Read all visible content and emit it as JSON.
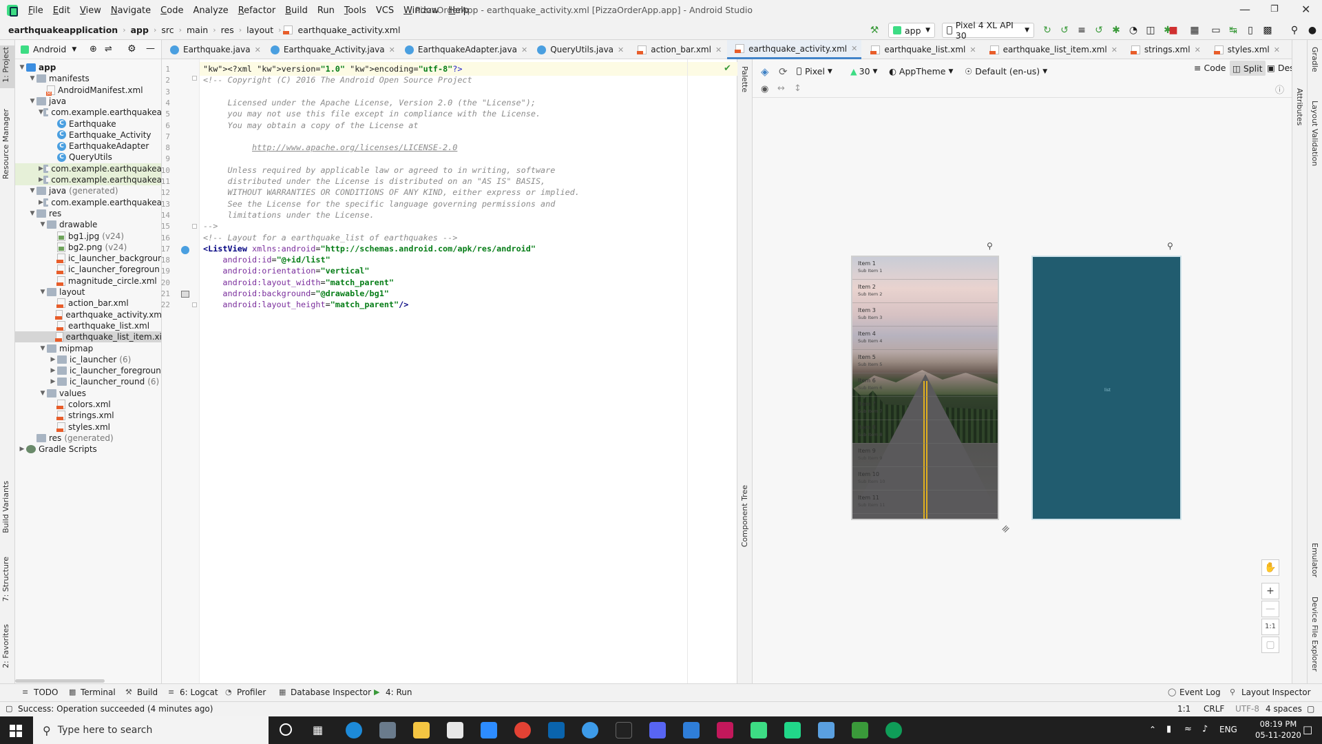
{
  "window": {
    "title": "PizzaOrderApp - earthquake_activity.xml [PizzaOrderApp.app] - Android Studio",
    "menu": [
      {
        "label": "File",
        "u": "F",
        "rest": "ile"
      },
      {
        "label": "Edit",
        "u": "E",
        "rest": "dit"
      },
      {
        "label": "View",
        "u": "V",
        "rest": "iew"
      },
      {
        "label": "Navigate",
        "u": "N",
        "rest": "avigate"
      },
      {
        "label": "Code",
        "u": "C",
        "rest": "ode"
      },
      {
        "label": "Analyze",
        "u": "",
        "rest": "Analyze"
      },
      {
        "label": "Refactor",
        "u": "R",
        "rest": "efactor"
      },
      {
        "label": "Build",
        "u": "B",
        "rest": "uild"
      },
      {
        "label": "Run",
        "u": "",
        "rest": "Run"
      },
      {
        "label": "Tools",
        "u": "T",
        "rest": "ools"
      },
      {
        "label": "VCS",
        "u": "",
        "rest": "VCS"
      },
      {
        "label": "Window",
        "u": "W",
        "rest": "indow"
      },
      {
        "label": "Help",
        "u": "H",
        "rest": "elp"
      }
    ]
  },
  "breadcrumb": [
    "earthquakeapplication",
    "app",
    "src",
    "main",
    "res",
    "layout",
    "earthquake_activity.xml"
  ],
  "toolbar": {
    "run_config": "app",
    "device": "Pixel 4 XL API 30"
  },
  "project": {
    "view_label": "Android",
    "tree": [
      {
        "label": "app",
        "icon": "module",
        "arrow": "▼",
        "depth": 0,
        "bold": true
      },
      {
        "label": "manifests",
        "icon": "folder",
        "arrow": "▼",
        "depth": 1
      },
      {
        "label": "AndroidManifest.xml",
        "icon": "manifest",
        "arrow": "",
        "depth": 2
      },
      {
        "label": "java",
        "icon": "folder",
        "arrow": "▼",
        "depth": 1
      },
      {
        "label": "com.example.earthquakea",
        "icon": "package",
        "arrow": "▼",
        "depth": 2
      },
      {
        "label": "Earthquake",
        "icon": "class",
        "arrow": "",
        "depth": 3
      },
      {
        "label": "Earthquake_Activity",
        "icon": "class",
        "arrow": "",
        "depth": 3
      },
      {
        "label": "EarthquakeAdapter",
        "icon": "class",
        "arrow": "",
        "depth": 3
      },
      {
        "label": "QueryUtils",
        "icon": "class",
        "arrow": "",
        "depth": 3
      },
      {
        "label": "com.example.earthquakea",
        "icon": "package",
        "arrow": "▶",
        "depth": 2,
        "hl": true,
        "suffix": ""
      },
      {
        "label": "com.example.earthquakea",
        "icon": "package",
        "arrow": "▶",
        "depth": 2,
        "hl": true,
        "suffix": ""
      },
      {
        "label": "java",
        "icon": "folder",
        "arrow": "▼",
        "depth": 1,
        "suffix": "(generated)"
      },
      {
        "label": "com.example.earthquakea",
        "icon": "package",
        "arrow": "▶",
        "depth": 2
      },
      {
        "label": "res",
        "icon": "folder",
        "arrow": "▼",
        "depth": 1
      },
      {
        "label": "drawable",
        "icon": "folder",
        "arrow": "▼",
        "depth": 2
      },
      {
        "label": "bg1.jpg",
        "icon": "image",
        "arrow": "",
        "depth": 3,
        "suffix": "(v24)"
      },
      {
        "label": "bg2.png",
        "icon": "image",
        "arrow": "",
        "depth": 3,
        "suffix": "(v24)"
      },
      {
        "label": "ic_launcher_backgrour",
        "icon": "xml",
        "arrow": "",
        "depth": 3
      },
      {
        "label": "ic_launcher_foregroun",
        "icon": "xml",
        "arrow": "",
        "depth": 3
      },
      {
        "label": "magnitude_circle.xml",
        "icon": "xml",
        "arrow": "",
        "depth": 3
      },
      {
        "label": "layout",
        "icon": "folder",
        "arrow": "▼",
        "depth": 2
      },
      {
        "label": "action_bar.xml",
        "icon": "xml",
        "arrow": "",
        "depth": 3
      },
      {
        "label": "earthquake_activity.xm",
        "icon": "xml",
        "arrow": "",
        "depth": 3
      },
      {
        "label": "earthquake_list.xml",
        "icon": "xml",
        "arrow": "",
        "depth": 3
      },
      {
        "label": "earthquake_list_item.xi",
        "icon": "xml",
        "arrow": "",
        "depth": 3,
        "sel": true
      },
      {
        "label": "mipmap",
        "icon": "folder",
        "arrow": "▼",
        "depth": 2
      },
      {
        "label": "ic_launcher",
        "icon": "folder",
        "arrow": "▶",
        "depth": 3,
        "suffix": "(6)"
      },
      {
        "label": "ic_launcher_foregroun",
        "icon": "folder",
        "arrow": "▶",
        "depth": 3
      },
      {
        "label": "ic_launcher_round",
        "icon": "folder",
        "arrow": "▶",
        "depth": 3,
        "suffix": "(6)"
      },
      {
        "label": "values",
        "icon": "folder",
        "arrow": "▼",
        "depth": 2
      },
      {
        "label": "colors.xml",
        "icon": "xml",
        "arrow": "",
        "depth": 3
      },
      {
        "label": "strings.xml",
        "icon": "xml",
        "arrow": "",
        "depth": 3
      },
      {
        "label": "styles.xml",
        "icon": "xml",
        "arrow": "",
        "depth": 3
      },
      {
        "label": "res",
        "icon": "folder",
        "arrow": "",
        "depth": 1,
        "suffix": "(generated)"
      },
      {
        "label": "Gradle Scripts",
        "icon": "gradle",
        "arrow": "▶",
        "depth": 0
      }
    ]
  },
  "tabs": [
    {
      "label": "Earthquake.java",
      "icon": "c"
    },
    {
      "label": "Earthquake_Activity.java",
      "icon": "c"
    },
    {
      "label": "EarthquakeAdapter.java",
      "icon": "c"
    },
    {
      "label": "QueryUtils.java",
      "icon": "c"
    },
    {
      "label": "action_bar.xml",
      "icon": "x"
    },
    {
      "label": "earthquake_activity.xml",
      "icon": "x",
      "active": true
    },
    {
      "label": "earthquake_list.xml",
      "icon": "x"
    },
    {
      "label": "earthquake_list_item.xml",
      "icon": "x"
    },
    {
      "label": "strings.xml",
      "icon": "x"
    },
    {
      "label": "styles.xml",
      "icon": "x"
    }
  ],
  "view_modes": {
    "code": "Code",
    "split": "Split",
    "design": "Design"
  },
  "code_lines": [
    "<?xml version=\"1.0\" encoding=\"utf-8\"?>",
    "<!-- Copyright (C) 2016 The Android Open Source Project",
    "",
    "     Licensed under the Apache License, Version 2.0 (the \"License\");",
    "     you may not use this file except in compliance with the License.",
    "     You may obtain a copy of the License at",
    "",
    "          http://www.apache.org/licenses/LICENSE-2.0",
    "",
    "     Unless required by applicable law or agreed to in writing, software",
    "     distributed under the License is distributed on an \"AS IS\" BASIS,",
    "     WITHOUT WARRANTIES OR CONDITIONS OF ANY KIND, either express or implied.",
    "     See the License for the specific language governing permissions and",
    "     limitations under the License.",
    "-->",
    "<!-- Layout for a earthquake_list of earthquakes -->",
    "<ListView xmlns:android=\"http://schemas.android.com/apk/res/android\"",
    "    android:id=\"@+id/list\"",
    "    android:orientation=\"vertical\"",
    "    android:layout_width=\"match_parent\"",
    "    android:background=\"@drawable/bg1\"",
    "    android:layout_height=\"match_parent\"/>"
  ],
  "design_toolbar": {
    "device": "Pixel",
    "api": "30",
    "theme": "AppTheme",
    "locale": "Default (en-us)"
  },
  "preview": {
    "items": [
      {
        "title": "Item 1",
        "sub": "Sub Item 1"
      },
      {
        "title": "Item 2",
        "sub": "Sub Item 2"
      },
      {
        "title": "Item 3",
        "sub": "Sub Item 3"
      },
      {
        "title": "Item 4",
        "sub": "Sub Item 4"
      },
      {
        "title": "Item 5",
        "sub": "Sub Item 5"
      },
      {
        "title": "Item 6",
        "sub": "Sub Item 6"
      },
      {
        "title": "Item 7",
        "sub": "Sub Item 7"
      },
      {
        "title": "Item 8",
        "sub": "Sub Item 8"
      },
      {
        "title": "Item 9",
        "sub": "Sub Item 9"
      },
      {
        "title": "Item 10",
        "sub": "Sub Item 10"
      },
      {
        "title": "Item 11",
        "sub": "Sub Item 11"
      }
    ],
    "blueprint_label": "list"
  },
  "side_tabs": {
    "project": "1: Project",
    "resource_manager": "Resource Manager",
    "build_variants": "Build Variants",
    "structure": "7: Structure",
    "favorites": "2: Favorites",
    "palette": "Palette",
    "component_tree": "Component Tree",
    "gradle": "Gradle",
    "attributes": "Attributes",
    "layout_validation": "Layout Validation",
    "emulator": "Emulator",
    "device_file_explorer": "Device File Explorer"
  },
  "bottom_tools": {
    "todo": "TODO",
    "terminal": "Terminal",
    "build": "Build",
    "logcat": "6: Logcat",
    "profiler": "Profiler",
    "db_inspector": "Database Inspector",
    "run": "4: Run",
    "event_log": "Event Log",
    "layout_inspector": "Layout Inspector"
  },
  "status": {
    "message": "Success: Operation succeeded (4 minutes ago)",
    "position": "1:1",
    "line_sep": "CRLF",
    "encoding": "UTF-8",
    "indent": "4 spaces"
  },
  "taskbar": {
    "search_placeholder": "Type here to search",
    "lang": "ENG",
    "time": "08:19 PM",
    "date": "05-11-2020"
  },
  "zoom": {
    "one_to_one": "1:1"
  }
}
